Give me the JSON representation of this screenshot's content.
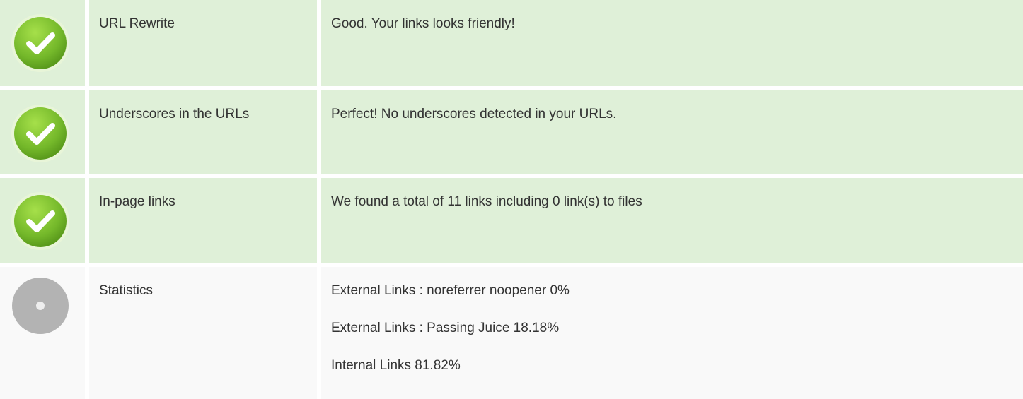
{
  "rows": [
    {
      "status": "good",
      "icon": "check-circle-icon",
      "name": "URL Rewrite",
      "messages": [
        "Good. Your links looks friendly!"
      ]
    },
    {
      "status": "good",
      "icon": "check-circle-icon",
      "name": "Underscores in the URLs",
      "messages": [
        "Perfect! No underscores detected in your URLs."
      ]
    },
    {
      "status": "good",
      "icon": "check-circle-icon",
      "name": "In-page links",
      "messages": [
        "We found a total of 11 links including 0 link(s) to files"
      ]
    },
    {
      "status": "neutral",
      "icon": "info-circle-icon",
      "name": "Statistics",
      "messages": [
        "External Links : noreferrer noopener 0%",
        "External Links : Passing Juice 18.18%",
        "Internal Links 81.82%"
      ]
    }
  ],
  "colors": {
    "good_bg": "#dff0d8",
    "neutral_bg": "#f9f9f9",
    "check_green": "#7cc52c",
    "neutral_gray": "#b3b3b3"
  }
}
